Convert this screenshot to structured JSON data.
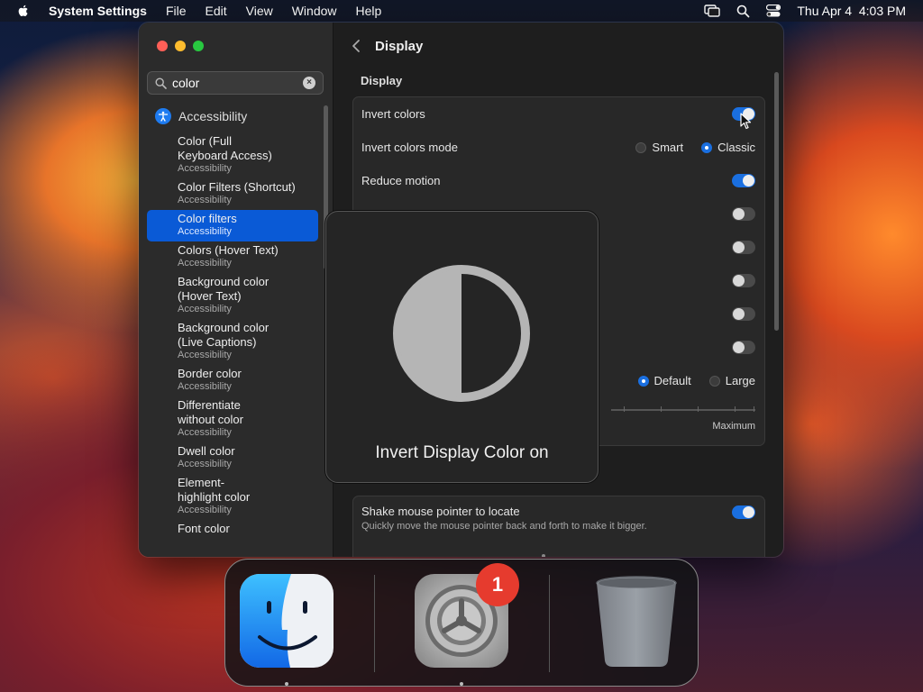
{
  "menubar": {
    "app_name": "System Settings",
    "menus": [
      "File",
      "Edit",
      "View",
      "Window",
      "Help"
    ],
    "datetime": "Thu Apr 4  4:03 PM"
  },
  "sidebar": {
    "search": {
      "value": "color"
    },
    "section_label": "Accessibility",
    "results": [
      {
        "title": "Color (Full Keyboard Access)",
        "title_lines": [
          "Color (Full",
          "Keyboard Access)"
        ],
        "subtitle": "Accessibility",
        "selected": false
      },
      {
        "title": "Color Filters (Shortcut)",
        "title_lines": [
          "Color Filters (Shortcut)"
        ],
        "subtitle": "Accessibility",
        "selected": false
      },
      {
        "title": "Color filters",
        "title_lines": [
          "Color filters"
        ],
        "subtitle": "Accessibility",
        "selected": true
      },
      {
        "title": "Colors (Hover Text)",
        "title_lines": [
          "Colors (Hover Text)"
        ],
        "subtitle": "Accessibility",
        "selected": false
      },
      {
        "title": "Background color (Hover Text)",
        "title_lines": [
          "Background color",
          "(Hover Text)"
        ],
        "subtitle": "Accessibility",
        "selected": false
      },
      {
        "title": "Background color (Live Captions)",
        "title_lines": [
          "Background color",
          "(Live Captions)"
        ],
        "subtitle": "Accessibility",
        "selected": false
      },
      {
        "title": "Border color",
        "title_lines": [
          "Border color"
        ],
        "subtitle": "Accessibility",
        "selected": false
      },
      {
        "title": "Differentiate without color",
        "title_lines": [
          "Differentiate",
          "without color"
        ],
        "subtitle": "Accessibility",
        "selected": false
      },
      {
        "title": "Dwell color",
        "title_lines": [
          "Dwell color"
        ],
        "subtitle": "Accessibility",
        "selected": false
      },
      {
        "title": "Element-highlight color",
        "title_lines": [
          "Element-",
          "highlight color"
        ],
        "subtitle": "Accessibility",
        "selected": false
      },
      {
        "title": "Font color",
        "title_lines": [
          "Font color"
        ],
        "subtitle": "",
        "selected": false
      }
    ]
  },
  "content": {
    "title": "Display",
    "section_display": "Display",
    "rows": {
      "invert_colors": {
        "label": "Invert colors",
        "on": true
      },
      "invert_mode": {
        "label": "Invert colors mode",
        "options": [
          "Smart",
          "Classic"
        ],
        "selected": "Classic"
      },
      "reduce_motion": {
        "label": "Reduce motion",
        "on": true
      }
    },
    "hidden_toggles": [
      false,
      false,
      false,
      false,
      false
    ],
    "pointer_size_options": [
      "Default",
      "Large"
    ],
    "pointer_size_selected": "Default",
    "slider_max_label": "Maximum",
    "shake": {
      "label": "Shake mouse pointer to locate",
      "description": "Quickly move the mouse pointer back and forth to make it bigger.",
      "on": true
    }
  },
  "hud": {
    "message": "Invert Display Color on"
  },
  "dock": {
    "apps": [
      "Finder",
      "System Settings",
      "Trash"
    ],
    "settings_badge": "1"
  },
  "colors": {
    "accent": "#1a6fe0",
    "selection": "#0a5ad6",
    "badge": "#e63b2e"
  }
}
